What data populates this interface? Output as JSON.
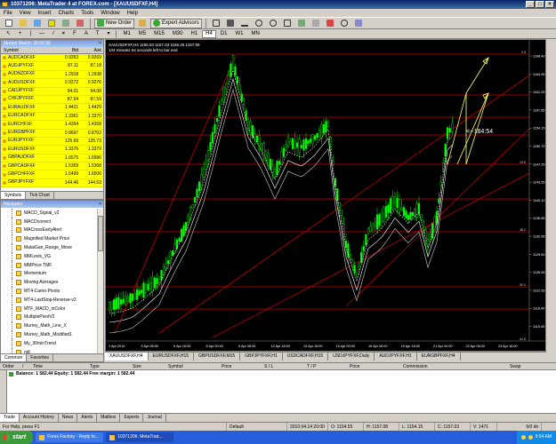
{
  "window": {
    "title": "10371206: MetaTrader 4 at FOREX.com - [XAUUSDFXF,H4]",
    "buttons": [
      "_",
      "□",
      "×"
    ]
  },
  "menu": [
    "File",
    "View",
    "Insert",
    "Charts",
    "Tools",
    "Window",
    "Help"
  ],
  "toolbar": {
    "new_order": "New Order",
    "expert_advisors": "Expert Advisors"
  },
  "timeframes": [
    "M1",
    "M5",
    "M15",
    "M30",
    "H1",
    "H4",
    "D1",
    "W1",
    "MN"
  ],
  "active_timeframe": "H4",
  "market_watch": {
    "title": "Market Watch: 20:00:56",
    "columns": [
      "Symbol",
      "Bid",
      "Ask"
    ],
    "rows": [
      {
        "symbol": "AUDCADFXF",
        "bid": "0.9263",
        "ask": "0.9269"
      },
      {
        "symbol": "AUDJPYFXF",
        "bid": "87.11",
        "ask": "87.18"
      },
      {
        "symbol": "AUDNZDFXF",
        "bid": "1.2918",
        "ask": "1.2938"
      },
      {
        "symbol": "AUDUSDFXF",
        "bid": "0.9272",
        "ask": "0.9276"
      },
      {
        "symbol": "CADJPYFXF",
        "bid": "94.01",
        "ask": "94.08"
      },
      {
        "symbol": "CHFJPYFXF",
        "bid": "87.54",
        "ask": "87.59"
      },
      {
        "symbol": "EURAUDFXF",
        "bid": "1.4421",
        "ask": "1.4429"
      },
      {
        "symbol": "EURCADFXF",
        "bid": "1.3361",
        "ask": "1.3370"
      },
      {
        "symbol": "EURCHFXF",
        "bid": "1.4354",
        "ask": "1.4358"
      },
      {
        "symbol": "EURGBPFXF",
        "bid": "0.8697",
        "ask": "0.8702"
      },
      {
        "symbol": "EURJPYFXF",
        "bid": "125.69",
        "ask": "125.73"
      },
      {
        "symbol": "EURUSDFXF",
        "bid": "1.3376",
        "ask": "1.3379"
      },
      {
        "symbol": "GBPAUDFXF",
        "bid": "1.6575",
        "ask": "1.6586"
      },
      {
        "symbol": "GBPCADFXF",
        "bid": "1.5359",
        "ask": "1.5368"
      },
      {
        "symbol": "GBPCHFFXF",
        "bid": "1.6499",
        "ask": "1.6506"
      },
      {
        "symbol": "GBPJPYFXF",
        "bid": "144.46",
        "ask": "144.53"
      }
    ],
    "tabs": [
      "Symbols",
      "Tick Chart"
    ]
  },
  "navigator": {
    "title": "Navigator",
    "items": [
      "MACD_Signal_v2",
      "MACDcorrect",
      "MACrossEarlyAlert",
      "Magnified Market Price",
      "MalaiGan_Range_Move",
      "MMLevls_VG",
      "MMPrice TMF",
      "Momentum",
      "Moving Averages",
      "MT4-Camo-Pivots",
      "MT4-LastStop-Reverse-v2",
      "MTF_MACD_inColor",
      "MultiplePivotV2",
      "Murrey_Math_Line_X",
      "Murrey_Math_Modified1",
      "My_30minTrend",
      "ndl",
      "ndl.5ig"
    ],
    "tabs": [
      "Common",
      "Favorites"
    ]
  },
  "chart": {
    "info_line1": "XAUUSDFXF,H4 1155.03 1157.03 1155.25 1157.08",
    "info_line2": "104 minutes 54 seconds left to bar end",
    "countdown": "<--184:54",
    "price_labels": [
      "1168.40",
      "1164.95",
      "1161.25",
      "1157.85",
      "1154.15",
      "1150.70",
      "1147.25",
      "1143.55",
      "1140.10",
      "1136.65",
      "1132.95",
      "1129.50",
      "1126.05",
      "1122.35",
      "1118.90",
      "1115.45"
    ],
    "level_labels": [
      "0.0",
      "23.6",
      "38.2",
      "50.0",
      "61.8"
    ],
    "time_labels": [
      "1 Apr 2010",
      "5 Apr 08:00",
      "6 Apr 16:00",
      "8 Apr 00:00",
      "9 Apr 08:00",
      "12 Apr 16:00",
      "13 Apr 16:00",
      "15 Apr 00:00",
      "16 Apr 08:00",
      "19 Apr 16:00",
      "21 Apr 00:00",
      "22 Apr 08:00",
      "23 Apr 16:00"
    ],
    "colors": {
      "background": "#000000",
      "candle": "#00ff00",
      "red_line": "#cc0000",
      "channel": "#c00000",
      "arrow": "#ffff66",
      "text": "#ffffff"
    }
  },
  "chart_tabs": [
    "XAUUSDFXF,H4",
    "EURUSDFXF,H15",
    "GBPUSDFXF,M15",
    "GBPJPYFXF,H1",
    "USDCADFXF,H15",
    "USDJPYFXF,Daily",
    "AUDJPYFXF,H1",
    "EURGBPFXF,H4"
  ],
  "terminal": {
    "columns": [
      "Order",
      "/",
      "Time",
      "Type",
      "Size",
      "Symbol",
      "Price",
      "S / L",
      "T / P",
      "Price",
      "Commission",
      "Swap"
    ],
    "balance": "Balance: 1 582.44  Equity: 1 582.44  Free margin: 1 582.44",
    "tabs": [
      "Trade",
      "Account History",
      "News",
      "Alerts",
      "Mailbox",
      "Experts",
      "Journal"
    ]
  },
  "status": {
    "help": "For Help, press F1",
    "profile": "Default",
    "datetime": "2010.04.14 20:00",
    "open": "O: 1154.55",
    "high": "H: 1157.08",
    "low": "L: 1154.15",
    "close": "C: 1157.03",
    "volume": "V: 1471",
    "traffic": "9/0 kb"
  },
  "taskbar": {
    "start": "start",
    "items": [
      "Forex Factory - Reply to...",
      "10371206: MetaTrad..."
    ],
    "clock": "9:54 AM"
  }
}
